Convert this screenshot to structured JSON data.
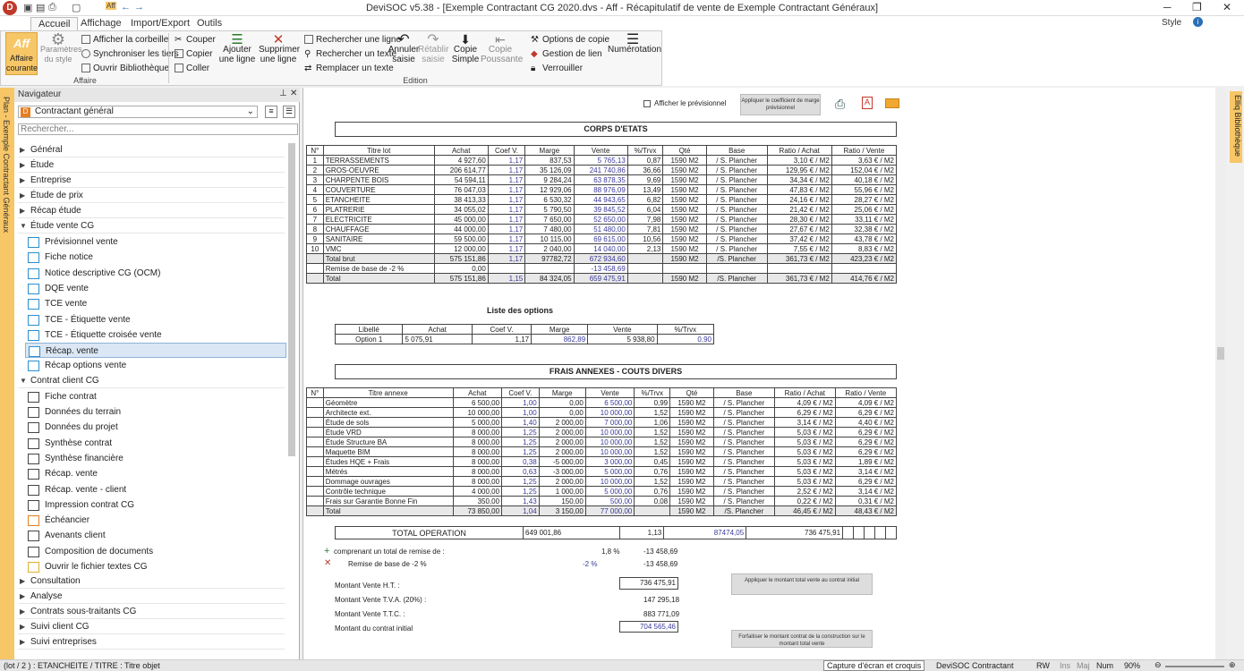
{
  "app": {
    "title": "DeviSOC v5.38 - [Exemple Contractant CG 2020.dvs - Aff - Récapitulatif de vente de Exemple Contractant Généraux]",
    "style_label": "Style",
    "logo": "D"
  },
  "menu": {
    "tabs": [
      "Accueil",
      "Affichage",
      "Import/Export",
      "Outils"
    ]
  },
  "ribbon": {
    "affaire_courante": "Affaire courante",
    "aff_icon": "Aff",
    "parametres_style": "Paramètres du style",
    "afficher_corbeille": "Afficher la corbeille",
    "synchroniser": "Synchroniser les tiers",
    "ouvrir_biblio": "Ouvrir Bibliothèque",
    "group_affaire": "Affaire",
    "couper": "Couper",
    "copier": "Copier",
    "coller": "Coller",
    "ajouter_ligne": "Ajouter une ligne",
    "supprimer_ligne": "Supprimer une ligne",
    "rechercher_ligne": "Rechercher une ligne",
    "rechercher_texte": "Rechercher un texte",
    "remplacer_texte": "Remplacer un texte",
    "annuler": "Annuler saisie",
    "retablir": "Rétablir saisie",
    "copie_simple": "Copie Simple",
    "copie_poussante": "Copie Poussante",
    "options_copie": "Options de copie",
    "gestion_lien": "Gestion de lien",
    "verrouiller": "Verrouiller",
    "numerotation": "Numérotation",
    "group_edition": "Edition"
  },
  "navigator": {
    "title": "Navigateur",
    "combo": "Contractant général",
    "search_placeholder": "Rechercher...",
    "side_left": "Plan - Exemple Contractant Généraux",
    "side_right": "Elliq Bibliothèque",
    "sections": [
      {
        "label": "Général",
        "open": false
      },
      {
        "label": "Étude",
        "open": false
      },
      {
        "label": "Entreprise",
        "open": false
      },
      {
        "label": "Étude de prix",
        "open": false
      },
      {
        "label": "Récap étude",
        "open": false
      },
      {
        "label": "Étude vente CG",
        "open": true
      }
    ],
    "etude_vente": [
      "Prévisionnel vente",
      "Fiche notice",
      "Notice descriptive CG (OCM)",
      "DQE vente",
      "TCE vente",
      "TCE - Étiquette vente",
      "TCE - Étiquette croisée vente",
      "Récap. vente",
      "Récap options vente"
    ],
    "contrat_label": "Contrat client CG",
    "contrat": [
      "Fiche contrat",
      "Données du terrain",
      "Données du projet",
      "Synthèse contrat",
      "Synthèse financière",
      "Récap. vente",
      "Récap. vente - client",
      "Impression contrat CG",
      "Échéancier",
      "Avenants client",
      "Composition de documents",
      "Ouvrir le fichier textes CG"
    ],
    "bottom": [
      "Consultation",
      "Analyse",
      "Contrats sous-traitants CG",
      "Suivi client CG",
      "Suivi entreprises"
    ]
  },
  "doc": {
    "show_prev": "Afficher le prévisionnel",
    "apply_coef_btn": "Appliquer le coefficient de marge prévisionnel",
    "corps_title": "CORPS D'ETATS",
    "headers": [
      "N°",
      "Titre lot",
      "Achat",
      "Coef V.",
      "Marge",
      "Vente",
      "%/Trvx",
      "Qté",
      "Base",
      "Ratio / Achat",
      "Ratio / Vente"
    ],
    "lots": [
      [
        "1",
        "TERRASSEMENTS",
        "4 927,60",
        "1,17",
        "837,53",
        "5 765,13",
        "0,87",
        "1590 M2",
        "/ S. Plancher",
        "3,10 € / M2",
        "3,63 € / M2"
      ],
      [
        "2",
        "GROS-OEUVRE",
        "206 614,77",
        "1,17",
        "35 126,09",
        "241 740,86",
        "36,66",
        "1590 M2",
        "/ S. Plancher",
        "129,95 € / M2",
        "152,04 € / M2"
      ],
      [
        "3",
        "CHARPENTE BOIS",
        "54 594,11",
        "1,17",
        "9 284,24",
        "63 878,35",
        "9,69",
        "1590 M2",
        "/ S. Plancher",
        "34,34 € / M2",
        "40,18 € / M2"
      ],
      [
        "4",
        "COUVERTURE",
        "76 047,03",
        "1,17",
        "12 929,06",
        "88 976,09",
        "13,49",
        "1590 M2",
        "/ S. Plancher",
        "47,83 € / M2",
        "55,96 € / M2"
      ],
      [
        "5",
        "ETANCHEITE",
        "38 413,33",
        "1,17",
        "6 530,32",
        "44 943,65",
        "6,82",
        "1590 M2",
        "/ S. Plancher",
        "24,16 € / M2",
        "28,27 € / M2"
      ],
      [
        "6",
        "PLATRERIE",
        "34 055,02",
        "1,17",
        "5 790,50",
        "39 845,52",
        "6,04",
        "1590 M2",
        "/ S. Plancher",
        "21,42 € / M2",
        "25,06 € / M2"
      ],
      [
        "7",
        "ELECTRICITE",
        "45 000,00",
        "1,17",
        "7 650,00",
        "52 650,00",
        "7,98",
        "1590 M2",
        "/ S. Plancher",
        "28,30 € / M2",
        "33,11 € / M2"
      ],
      [
        "8",
        "CHAUFFAGE",
        "44 000,00",
        "1,17",
        "7 480,00",
        "51 480,00",
        "7,81",
        "1590 M2",
        "/ S. Plancher",
        "27,67 € / M2",
        "32,38 € / M2"
      ],
      [
        "9",
        "SANITAIRE",
        "59 500,00",
        "1,17",
        "10 115,00",
        "69 615,00",
        "10,56",
        "1590 M2",
        "/ S. Plancher",
        "37,42 € / M2",
        "43,78 € / M2"
      ],
      [
        "10",
        "VMC",
        "12 000,00",
        "1,17",
        "2 040,00",
        "14 040,00",
        "2,13",
        "1590 M2",
        "/ S. Plancher",
        "7,55 € / M2",
        "8,83 € / M2"
      ]
    ],
    "total_brut": [
      "",
      "Total brut",
      "575 151,86",
      "1,17",
      "97782,72",
      "672 934,60",
      "",
      "1590 M2",
      "/S. Plancher",
      "361,73 € / M2",
      "423,23 € / M2"
    ],
    "remise": [
      "",
      "Remise de base de -2 %",
      "0,00",
      "",
      "",
      "-13 458,69",
      "",
      "",
      "",
      "",
      ""
    ],
    "total": [
      "",
      "Total",
      "575 151,86",
      "1,15",
      "84 324,05",
      "659 475,91",
      "",
      "1590 M2",
      "/S. Plancher",
      "361,73 € / M2",
      "414,76 € / M2"
    ],
    "options_title": "Liste des options",
    "options_headers": [
      "Libellé",
      "Achat",
      "Coef V.",
      "Marge",
      "Vente",
      "%/Trvx"
    ],
    "options": [
      [
        "Option 1",
        "5 075,91",
        "1,17",
        "862,89",
        "5 938,80",
        "0,90"
      ]
    ],
    "frais_title": "FRAIS ANNEXES - COUTS DIVERS",
    "frais_headers": [
      "N°",
      "Titre annexe",
      "Achat",
      "Coef V.",
      "Marge",
      "Vente",
      "%/Trvx",
      "Qté",
      "Base",
      "Ratio / Achat",
      "Ratio / Vente"
    ],
    "frais": [
      [
        "",
        "Géomètre",
        "6 500,00",
        "1,00",
        "0,00",
        "6 500,00",
        "0,99",
        "1590 M2",
        "/ S. Plancher",
        "4,09 € / M2",
        "4,09 € / M2"
      ],
      [
        "",
        "Architecte ext.",
        "10 000,00",
        "1,00",
        "0,00",
        "10 000,00",
        "1,52",
        "1590 M2",
        "/ S. Plancher",
        "6,29 € / M2",
        "6,29 € / M2"
      ],
      [
        "",
        "Étude de sols",
        "5 000,00",
        "1,40",
        "2 000,00",
        "7 000,00",
        "1,06",
        "1590 M2",
        "/ S. Plancher",
        "3,14 € / M2",
        "4,40 € / M2"
      ],
      [
        "",
        "Étude VRD",
        "8 000,00",
        "1,25",
        "2 000,00",
        "10 000,00",
        "1,52",
        "1590 M2",
        "/ S. Plancher",
        "5,03 € / M2",
        "6,29 € / M2"
      ],
      [
        "",
        "Étude Structure BA",
        "8 000,00",
        "1,25",
        "2 000,00",
        "10 000,00",
        "1,52",
        "1590 M2",
        "/ S. Plancher",
        "5,03 € / M2",
        "6,29 € / M2"
      ],
      [
        "",
        "Maquette BIM",
        "8 000,00",
        "1,25",
        "2 000,00",
        "10 000,00",
        "1,52",
        "1590 M2",
        "/ S. Plancher",
        "5,03 € / M2",
        "6,29 € / M2"
      ],
      [
        "",
        "Études HQE + Frais",
        "8 000,00",
        "0,38",
        "-5 000,00",
        "3 000,00",
        "0,45",
        "1590 M2",
        "/ S. Plancher",
        "5,03 € / M2",
        "1,89 € / M2"
      ],
      [
        "",
        "Métrés",
        "8 000,00",
        "0,63",
        "-3 000,00",
        "5 000,00",
        "0,76",
        "1590 M2",
        "/ S. Plancher",
        "5,03 € / M2",
        "3,14 € / M2"
      ],
      [
        "",
        "Dommage ouvrages",
        "8 000,00",
        "1,25",
        "2 000,00",
        "10 000,00",
        "1,52",
        "1590 M2",
        "/ S. Plancher",
        "5,03 € / M2",
        "6,29 € / M2"
      ],
      [
        "",
        "Contrôle technique",
        "4 000,00",
        "1,25",
        "1 000,00",
        "5 000,00",
        "0,76",
        "1590 M2",
        "/ S. Plancher",
        "2,52 € / M2",
        "3,14 € / M2"
      ],
      [
        "",
        "Frais sur Garantie Bonne Fin",
        "350,00",
        "1,43",
        "150,00",
        "500,00",
        "0,08",
        "1590 M2",
        "/ S. Plancher",
        "0,22 € / M2",
        "0,31 € / M2"
      ]
    ],
    "frais_total": [
      "",
      "Total",
      "73 850,00",
      "1,04",
      "3 150,00",
      "77 000,00",
      "",
      "1590 M2",
      "/S. Plancher",
      "46,45 € / M2",
      "48,43 € / M2"
    ],
    "total_operation": [
      "",
      "TOTAL OPERATION",
      "649 001,86",
      "1,13",
      "87474,05",
      "736 475,91",
      "",
      "",
      "",
      "",
      ""
    ],
    "comprenant_label": "comprenant un total de remise de :",
    "comprenant_pct": "1,8 %",
    "comprenant_val": "-13 458,69",
    "remise_label": "Remise de base de -2 %",
    "remise_pct": "-2 %",
    "remise_val": "-13 458,69",
    "montant_ht_label": "Montant Vente H.T. :",
    "montant_ht": "736 475,91",
    "tva_label": "Montant Vente T.V.A. (20%) :",
    "tva": "147 295,18",
    "ttc_label": "Montant Vente T.T.C. :",
    "ttc": "883 771,09",
    "initial_label": "Montant du contrat initial",
    "initial": "704 565,46",
    "apply_montant_btn": "Appliquer le montant total vente au contrat initial",
    "forfait_btn": "Forfaitiser le montant contrat de la construction sur le montant total vente"
  },
  "status": {
    "left": "(lot / 2 ) : ETANCHEITE / TITRE : Titre objet",
    "tooltip": "Capture d'écran et croquis",
    "product": "DeviSOC Contractant",
    "rw": "RW",
    "ins": "Ins",
    "maj": "Maj",
    "num": "Num",
    "zoom": "90%"
  }
}
